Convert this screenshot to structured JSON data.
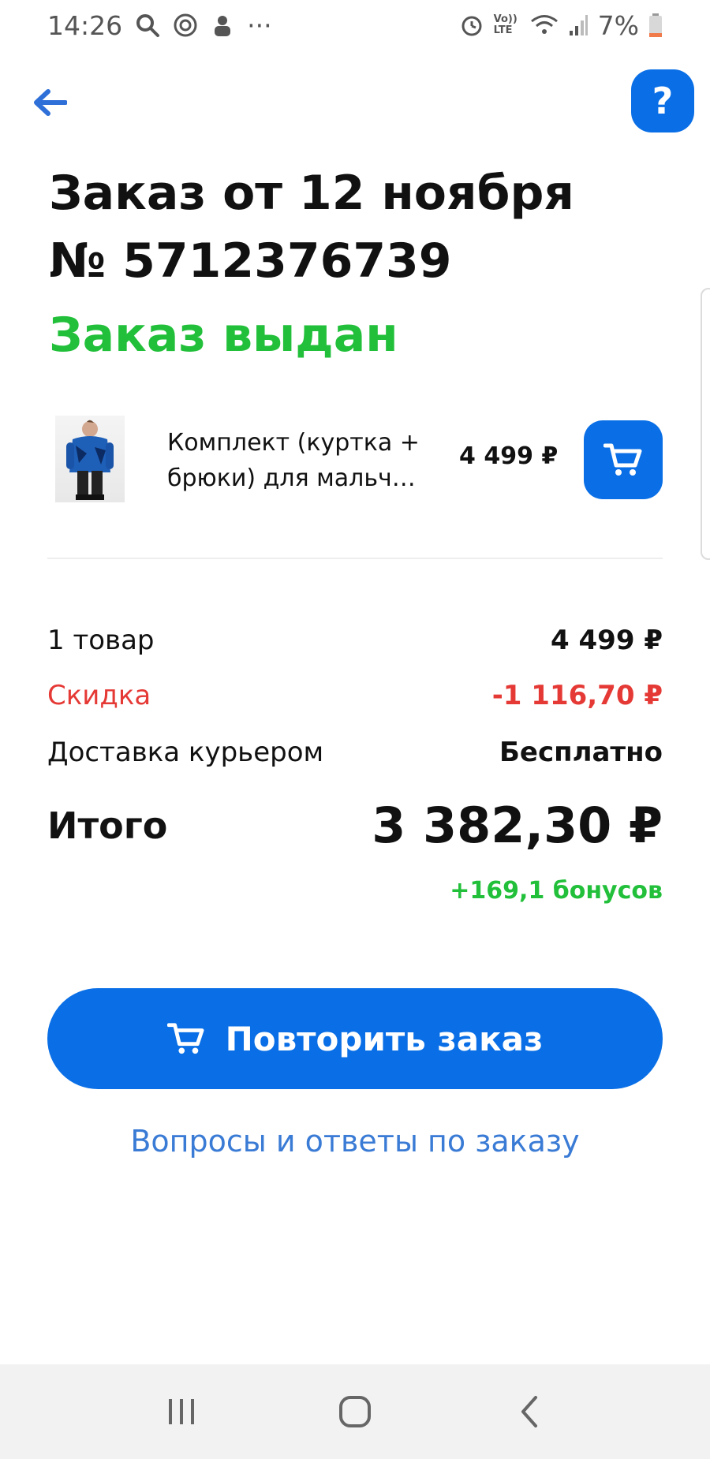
{
  "status_bar": {
    "time": "14:26",
    "more": "···",
    "lte": "Vo)) LTE",
    "battery": "7%"
  },
  "header": {
    "help": "?"
  },
  "order": {
    "title_line1": "Заказ от 12 ноября",
    "title_line2": "№ 5712376739",
    "status": "Заказ выдан"
  },
  "item": {
    "name": "Комплект (куртка + брюки) для мальч…",
    "price": "4 499 ₽"
  },
  "summary": {
    "items_label": "1 товар",
    "items_value": "4 499 ₽",
    "discount_label": "Скидка",
    "discount_value": "-1 116,70 ₽",
    "delivery_label": "Доставка курьером",
    "delivery_value": "Бесплатно",
    "total_label": "Итого",
    "total_value": "3 382,30 ₽",
    "bonus": "+169,1 бонусов"
  },
  "actions": {
    "repeat_label": "Повторить заказ",
    "faq_label": "Вопросы и ответы по заказу"
  },
  "colors": {
    "accent": "#0a6fe6",
    "success": "#22c03a",
    "danger": "#e53935",
    "link": "#3a7bd5"
  },
  "icons": [
    "search-icon",
    "target-icon",
    "app-icon",
    "alarm-icon",
    "wifi-icon",
    "signal-icon",
    "battery-icon",
    "back-arrow-icon",
    "cart-icon",
    "recent-apps-icon",
    "home-icon",
    "nav-back-icon"
  ]
}
